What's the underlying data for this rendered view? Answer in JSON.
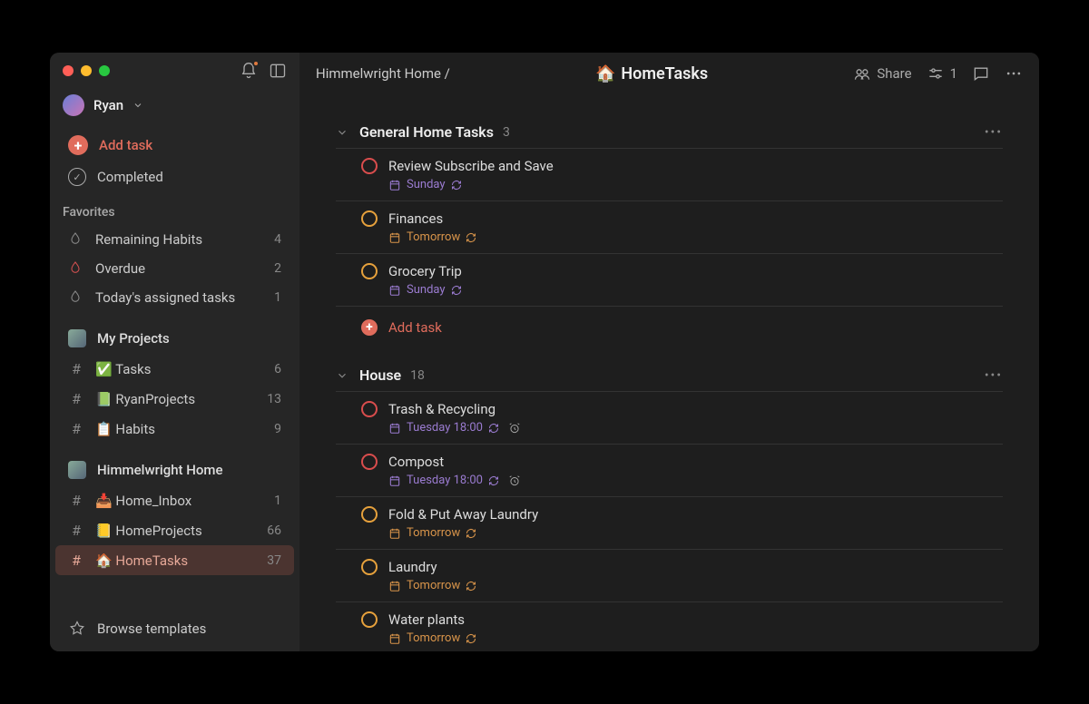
{
  "user": {
    "name": "Ryan"
  },
  "sidebar": {
    "add_task_label": "Add task",
    "completed_label": "Completed",
    "browse_templates_label": "Browse templates",
    "favorites_label": "Favorites",
    "favorites": [
      {
        "label": "Remaining Habits",
        "count": "4",
        "color": "gray"
      },
      {
        "label": "Overdue",
        "count": "2",
        "color": "red"
      },
      {
        "label": "Today's assigned tasks",
        "count": "1",
        "color": "gray"
      }
    ],
    "workspaces": [
      {
        "name": "My Projects",
        "projects": [
          {
            "emoji": "✅",
            "label": "Tasks",
            "count": "6"
          },
          {
            "emoji": "📗",
            "label": "RyanProjects",
            "count": "13"
          },
          {
            "emoji": "📋",
            "label": "Habits",
            "count": "9"
          }
        ]
      },
      {
        "name": "Himmelwright Home",
        "projects": [
          {
            "emoji": "📥",
            "label": "Home_Inbox",
            "count": "1"
          },
          {
            "emoji": "📒",
            "label": "HomeProjects",
            "count": "66"
          },
          {
            "emoji": "🏠",
            "label": "HomeTasks",
            "count": "37",
            "active": true
          }
        ]
      }
    ]
  },
  "topbar": {
    "breadcrumb": "Himmelwright Home /",
    "project_emoji": "🏠",
    "project_name": "HomeTasks",
    "share_label": "Share",
    "filter_count": "1"
  },
  "sections": [
    {
      "title": "General Home Tasks",
      "count": "3",
      "add_task_label": "Add task",
      "tasks": [
        {
          "title": "Review Subscribe and Save",
          "priority": "red",
          "date": "Sunday",
          "date_color": "purple",
          "recur": true,
          "alarm": false
        },
        {
          "title": "Finances",
          "priority": "orange",
          "date": "Tomorrow",
          "date_color": "orange",
          "recur": true,
          "alarm": false
        },
        {
          "title": "Grocery Trip",
          "priority": "orange",
          "date": "Sunday",
          "date_color": "purple",
          "recur": true,
          "alarm": false
        }
      ]
    },
    {
      "title": "House",
      "count": "18",
      "tasks": [
        {
          "title": "Trash & Recycling",
          "priority": "red",
          "date": "Tuesday 18:00",
          "date_color": "purple",
          "recur": true,
          "alarm": true
        },
        {
          "title": "Compost",
          "priority": "red",
          "date": "Tuesday 18:00",
          "date_color": "purple",
          "recur": true,
          "alarm": true
        },
        {
          "title": "Fold & Put Away Laundry",
          "priority": "orange",
          "date": "Tomorrow",
          "date_color": "orange",
          "recur": true,
          "alarm": false
        },
        {
          "title": "Laundry",
          "priority": "orange",
          "date": "Tomorrow",
          "date_color": "orange",
          "recur": true,
          "alarm": false
        },
        {
          "title": "Water plants",
          "priority": "orange",
          "date": "Tomorrow",
          "date_color": "orange",
          "recur": true,
          "alarm": false
        }
      ]
    }
  ]
}
